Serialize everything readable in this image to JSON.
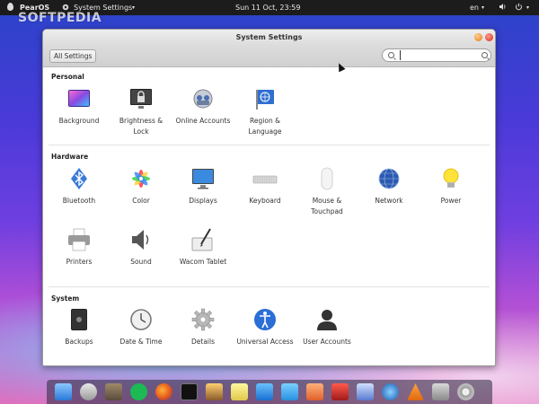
{
  "top_panel": {
    "distro": "PearOS",
    "app_menu": "System Settings",
    "clock": "Sun 11 Oct, 23:59",
    "language": "en"
  },
  "watermark": "SOFTPEDIA",
  "window": {
    "title": "System Settings",
    "all_settings_label": "All Settings",
    "search": {
      "value": "",
      "placeholder": ""
    }
  },
  "sections": {
    "personal": {
      "title": "Personal",
      "items": [
        {
          "label": "Background",
          "icon": "background-icon"
        },
        {
          "label": "Brightness & Lock",
          "icon": "brightness-lock-icon"
        },
        {
          "label": "Online Accounts",
          "icon": "online-accounts-icon"
        },
        {
          "label": "Region & Language",
          "icon": "region-language-icon"
        }
      ]
    },
    "hardware": {
      "title": "Hardware",
      "items": [
        {
          "label": "Bluetooth",
          "icon": "bluetooth-icon"
        },
        {
          "label": "Color",
          "icon": "color-icon"
        },
        {
          "label": "Displays",
          "icon": "displays-icon"
        },
        {
          "label": "Keyboard",
          "icon": "keyboard-icon"
        },
        {
          "label": "Mouse & Touchpad",
          "icon": "mouse-icon"
        },
        {
          "label": "Network",
          "icon": "network-icon"
        },
        {
          "label": "Power",
          "icon": "power-icon"
        },
        {
          "label": "Printers",
          "icon": "printer-icon"
        },
        {
          "label": "Sound",
          "icon": "sound-icon"
        },
        {
          "label": "Wacom Tablet",
          "icon": "wacom-tablet-icon"
        }
      ]
    },
    "system": {
      "title": "System",
      "items": [
        {
          "label": "Backups",
          "icon": "backups-icon"
        },
        {
          "label": "Date & Time",
          "icon": "clock-icon"
        },
        {
          "label": "Details",
          "icon": "gear-icon"
        },
        {
          "label": "Universal Access",
          "icon": "accessibility-icon"
        },
        {
          "label": "User Accounts",
          "icon": "user-icon"
        }
      ]
    }
  },
  "dock": {
    "items": [
      "finder-icon",
      "launchpad-icon",
      "contacts-icon",
      "spotify-icon",
      "firefox-icon",
      "terminal-icon",
      "photos-icon",
      "notes-icon",
      "word-icon",
      "writer-icon",
      "impress-icon",
      "red-app-icon",
      "preview-icon",
      "quicktime-icon",
      "vlc-icon",
      "utilities-icon",
      "settings-icon"
    ]
  },
  "colors": {
    "window_bg": "#ffffff",
    "panel_bg": "#1c1c1c",
    "accent": "#4a7bd4"
  }
}
